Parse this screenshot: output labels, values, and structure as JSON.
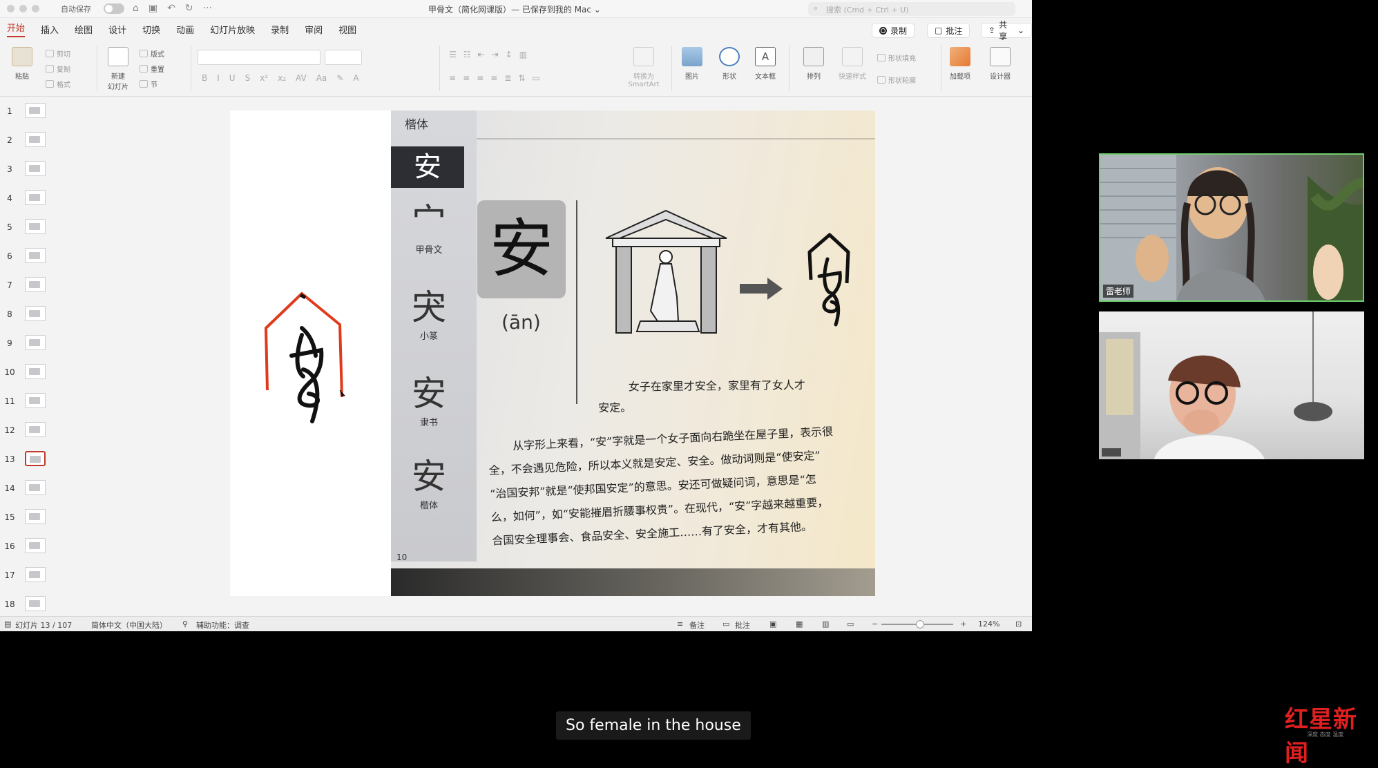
{
  "window": {
    "autosave_label": "自动保存",
    "doc_title": "甲骨文（简化网课版）— 已保存到我的 Mac ⌄",
    "search_placeholder": "搜索 (Cmd + Ctrl + U)"
  },
  "tabs": [
    "开始",
    "插入",
    "绘图",
    "设计",
    "切换",
    "动画",
    "幻灯片放映",
    "录制",
    "审阅",
    "视图"
  ],
  "ribbon_buttons": {
    "record": "录制",
    "comment": "批注",
    "share": "共享"
  },
  "ribbon": {
    "paste": "粘贴",
    "cut": "剪切",
    "copy": "复制",
    "format": "格式",
    "new_slide_1": "新建",
    "new_slide_2": "幻灯片",
    "layout": "版式",
    "reset": "重置",
    "section": "节",
    "smartart_1": "转换为",
    "smartart_2": "SmartArt",
    "picture": "图片",
    "shape": "形状",
    "textbox": "文本框",
    "arrange": "排列",
    "quick_styles": "快速样式",
    "shape_fill": "形状填充",
    "shape_outline": "形状轮廓",
    "addins": "加载项",
    "designer": "设计器"
  },
  "thumbnails": [
    "1",
    "2",
    "3",
    "4",
    "5",
    "6",
    "7",
    "8",
    "9",
    "10",
    "11",
    "12",
    "13",
    "14",
    "15",
    "16",
    "17",
    "18"
  ],
  "selected_slide": 13,
  "slide": {
    "band_top": "楷体",
    "band_head": "安",
    "band_items": [
      {
        "glyph": "宀",
        "caption": "甲骨文"
      },
      {
        "glyph": "宊",
        "caption": "小篆"
      },
      {
        "glyph": "安",
        "caption": "隶书"
      },
      {
        "glyph": "安",
        "caption": "楷体"
      }
    ],
    "card_char": "安",
    "pinyin": "(ān)",
    "caption_line1": "女子在家里才安全，家里有了女人才",
    "caption_line2": "安定。",
    "paragraph": [
      "从字形上来看，“安”字就是一个女子面向右跪坐在屋子里，表示很",
      "全，不会遇见危险，所以本义就是安定、安全。做动词则是“使安定”",
      "“治国安邦”就是“使邦国安定”的意思。安还可做疑问词，意思是“怎",
      "么，如何”，如“安能摧眉折腰事权贵”。在现代，“安”字越来越重要，",
      "合国安全理事会、食品安全、安全施工……有了安全，才有其他。"
    ],
    "page_number": "10"
  },
  "status": {
    "slide_counter": "幻灯片 13 / 107",
    "language": "简体中文（中国大陆）",
    "accessibility": "辅助功能：调查",
    "notes": "备注",
    "comments": "批注",
    "zoom": "124%"
  },
  "video": {
    "participant1": "雷老师"
  },
  "subtitle": "So female in the house",
  "watermark": "红星新闻",
  "watermark_sub": "深度 态度 温度"
}
